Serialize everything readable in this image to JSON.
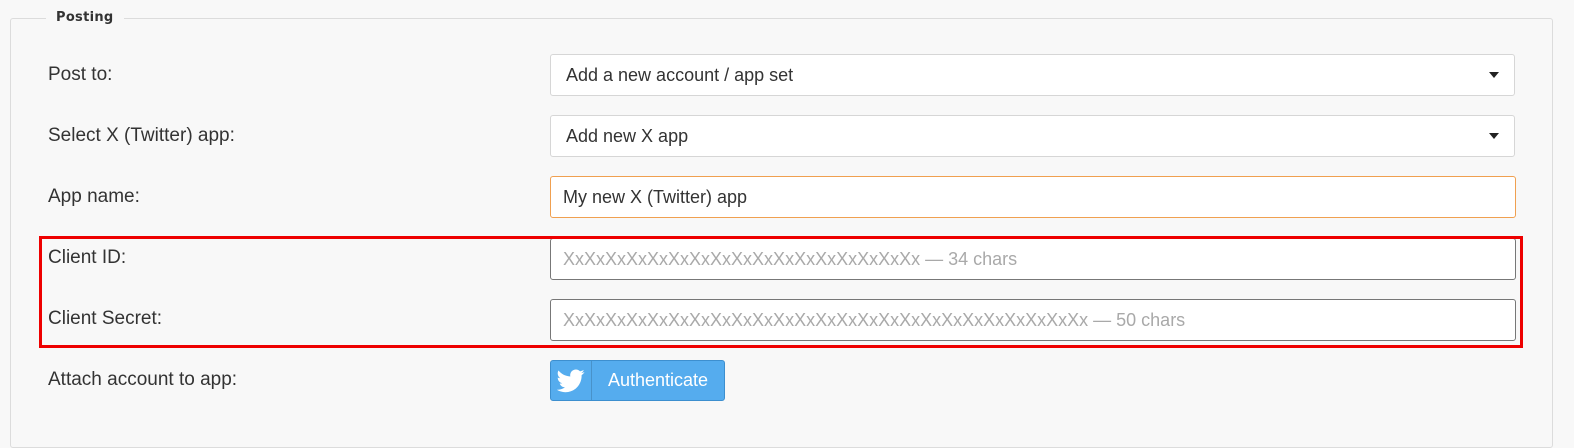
{
  "section": {
    "legend": "Posting"
  },
  "post_to": {
    "label": "Post to:",
    "selected": "Add a new account / app set"
  },
  "select_app": {
    "label": "Select X (Twitter) app:",
    "selected": "Add new X app"
  },
  "app_name": {
    "label": "App name:",
    "value": "My new X (Twitter) app"
  },
  "client_id": {
    "label": "Client ID:",
    "placeholder": "XxXxXxXxXxXxXxXxXxXxXxXxXxXxXxXxXx — 34 chars"
  },
  "client_secret": {
    "label": "Client Secret:",
    "placeholder": "XxXxXxXxXxXxXxXxXxXxXxXxXxXxXxXxXxXxXxXxXxXxXxXxXx — 50 chars"
  },
  "attach": {
    "label": "Attach account to app:",
    "button_label": "Authenticate",
    "button_icon": "twitter-bird-icon"
  },
  "colors": {
    "twitter_blue": "#55acee",
    "highlight_red": "#ee0000",
    "focus_orange": "#f0a050"
  }
}
